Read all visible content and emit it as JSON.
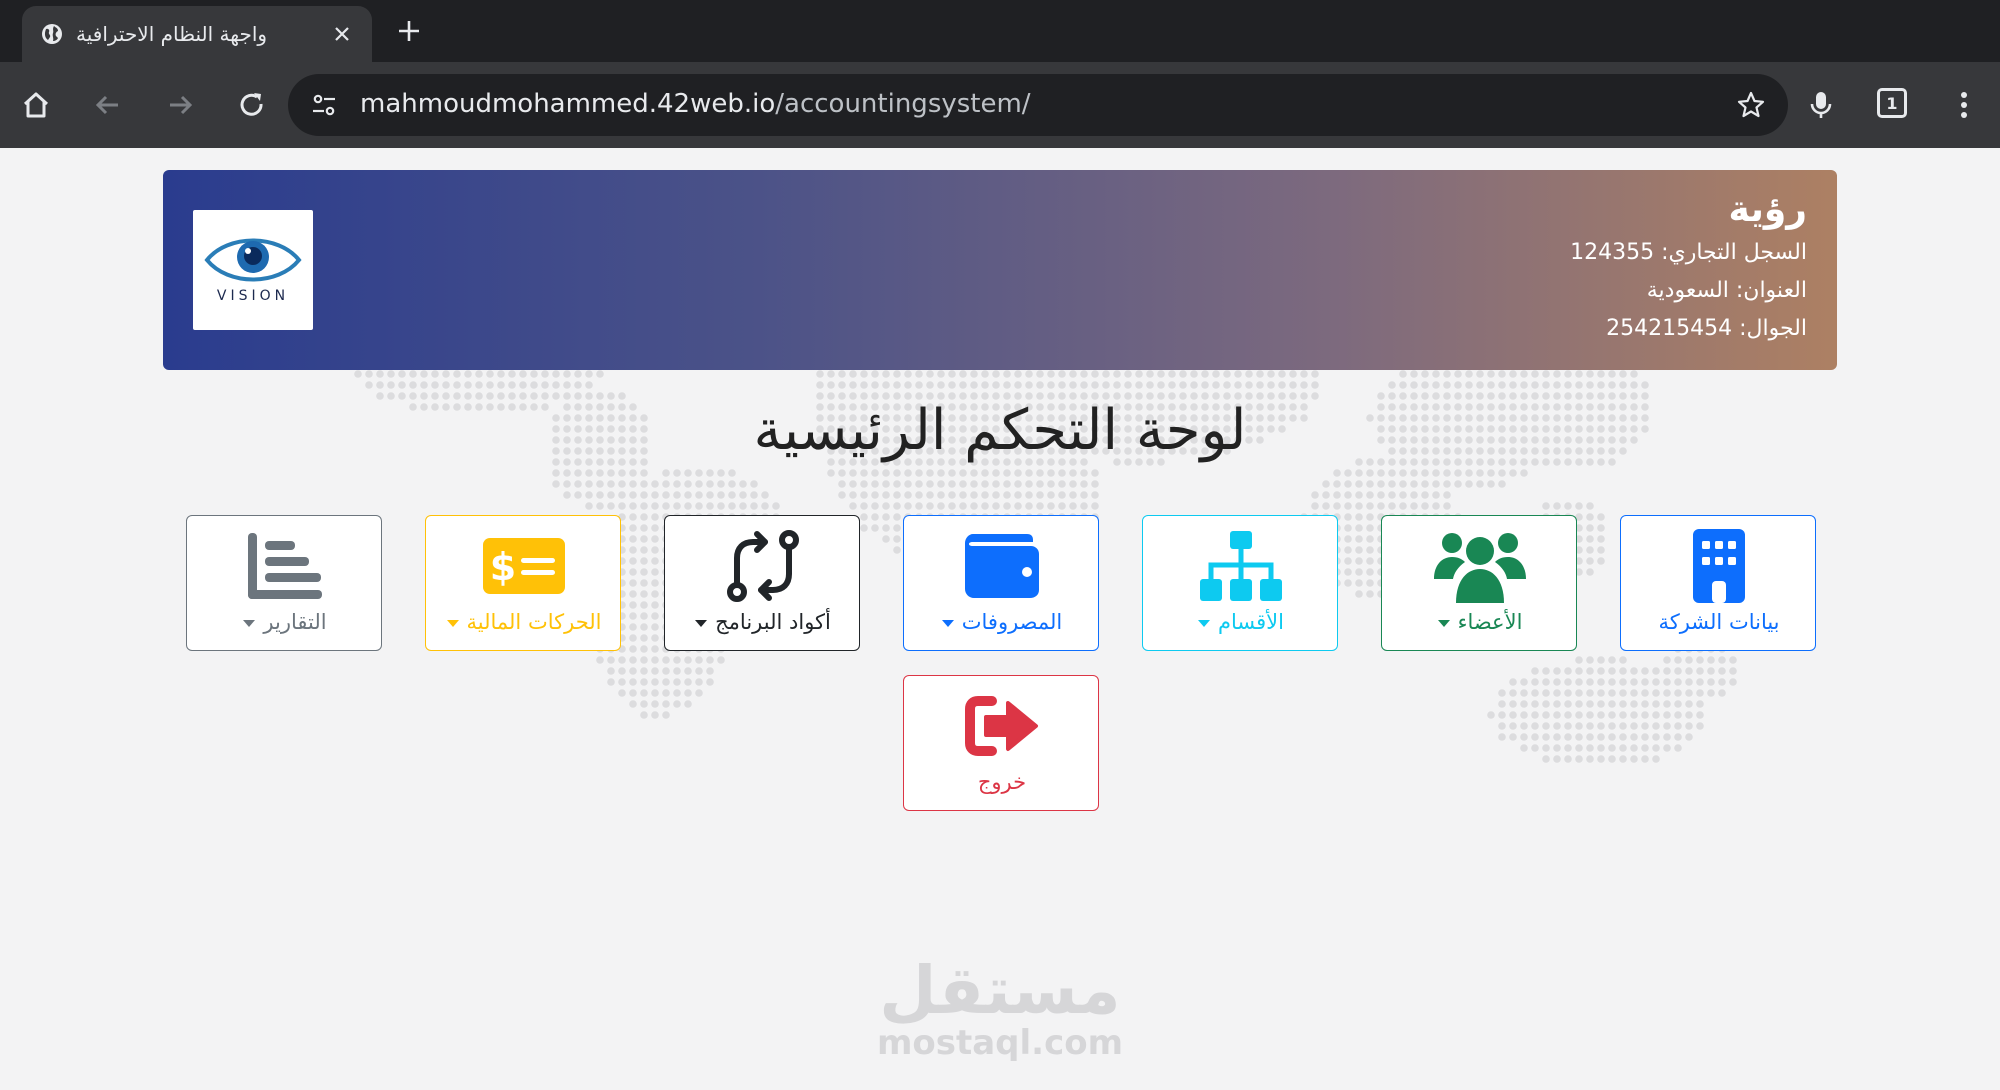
{
  "browser": {
    "tab_title": "واجهة النظام الاحترافية",
    "url_host": "mahmoudmohammed.42web.io",
    "url_path": "/accountingsystem/",
    "tab_count": "1"
  },
  "header": {
    "logo_text": "VISION",
    "company_name": "رؤية",
    "registry": "السجل التجاري: 124355",
    "address": "العنوان: السعودية",
    "mobile": "الجوال: 254215454"
  },
  "page_title": "لوحة التحكم الرئيسية",
  "tiles": [
    {
      "label": "بيانات الشركة",
      "color": "#0d6efd",
      "dropdown": false,
      "icon": "building-icon"
    },
    {
      "label": "الأعضاء",
      "color": "#198754",
      "dropdown": true,
      "icon": "users-icon"
    },
    {
      "label": "الأقسام",
      "color": "#0dcaf0",
      "dropdown": true,
      "icon": "sitemap-icon"
    },
    {
      "label": "المصروفات",
      "color": "#0d6efd",
      "dropdown": true,
      "icon": "wallet-icon"
    },
    {
      "label": "أكواد البرنامج",
      "color": "#212529",
      "dropdown": true,
      "icon": "code-compare-icon"
    },
    {
      "label": "الحركات المالية",
      "color": "#ffc107",
      "dropdown": true,
      "icon": "money-bill-icon"
    },
    {
      "label": "التقارير",
      "color": "#6c757d",
      "dropdown": true,
      "icon": "list-chart-icon"
    },
    {
      "label": "خروج",
      "color": "#dc3545",
      "dropdown": false,
      "icon": "logout-icon"
    }
  ],
  "watermark": {
    "arabic": "مستقل",
    "latin": "mostaql.com"
  }
}
